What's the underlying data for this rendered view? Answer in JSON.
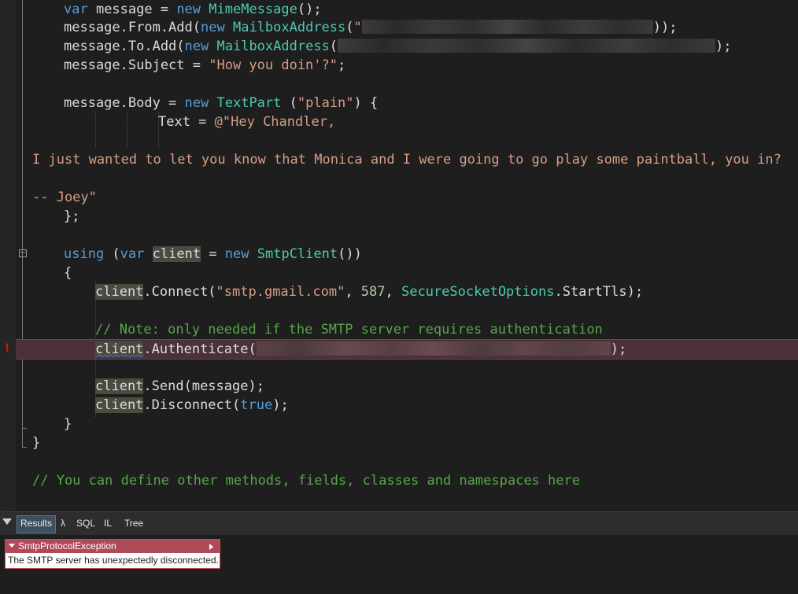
{
  "editor": {
    "lines": {
      "l1": {
        "p1": "var",
        "p2": " message = ",
        "p3": "new",
        "p4": " ",
        "p5": "MimeMessage",
        "p6": "();"
      },
      "l2": {
        "p1": "message.From.Add(",
        "p2": "new",
        "p3": " ",
        "p4": "MailboxAddress",
        "p5": "(",
        "p6": "\"",
        "p7": "));"
      },
      "l3": {
        "p1": "message.To.Add(",
        "p2": "new",
        "p3": " ",
        "p4": "MailboxAddress",
        "p5": "(",
        "p6": ");"
      },
      "l4": {
        "p1": "message.Subject = ",
        "p2": "\"How you doin'?\"",
        "p3": ";"
      },
      "l5": {
        "p1": "message.Body = ",
        "p2": "new",
        "p3": " ",
        "p4": "TextPart",
        "p5": " (",
        "p6": "\"plain\"",
        "p7": ") {"
      },
      "l6": {
        "p1": "Text = ",
        "p2": "@\"Hey Chandler,"
      },
      "l7": {
        "p1": "I just wanted to let you know that Monica and I were going to go play some paintball, you in?"
      },
      "l8": {
        "p1": "-- Joey\""
      },
      "l9": {
        "p1": "};"
      },
      "l10": {
        "p1": "using",
        "p2": " (",
        "p3": "var",
        "p4": " ",
        "p5": "client",
        "p6": " = ",
        "p7": "new",
        "p8": " ",
        "p9": "SmtpClient",
        "p10": "())"
      },
      "l11": {
        "p1": "{"
      },
      "l12": {
        "p1": "client",
        "p2": ".Connect(",
        "p3": "\"smtp.gmail.com\"",
        "p4": ", ",
        "p5": "587",
        "p6": ", ",
        "p7": "SecureSocketOptions",
        "p8": ".StartTls);"
      },
      "l13": {
        "p1": "// Note: only needed if the SMTP server requires authentication"
      },
      "l14": {
        "p1": "client",
        "p2": ".Authenticate(",
        "p3": ");"
      },
      "l15": {
        "p1": "client",
        "p2": ".Send(message);"
      },
      "l16": {
        "p1": "client",
        "p2": ".Disconnect(",
        "p3": "true",
        "p4": ");"
      },
      "l17": {
        "p1": "}"
      },
      "l18": {
        "p1": "}"
      },
      "l19": {
        "p1": "// You can define other methods, fields, classes and namespaces here"
      }
    },
    "error_marker": "!",
    "fold_glyph": "−"
  },
  "bottom_tabs": {
    "items": [
      {
        "label": "Results"
      },
      {
        "label": "λ"
      },
      {
        "label": "SQL"
      },
      {
        "label": "IL"
      },
      {
        "label": "Tree"
      }
    ]
  },
  "exception": {
    "type": "SmtpProtocolException",
    "message": "The SMTP server has unexpectedly disconnected."
  },
  "colors": {
    "keyword": "#569cd6",
    "type": "#4ec9b0",
    "string": "#d69d85",
    "number": "#b5cea8",
    "comment": "#57a64a",
    "error": "#e51400"
  }
}
